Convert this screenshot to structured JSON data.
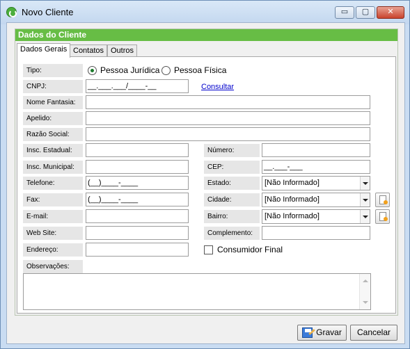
{
  "window": {
    "title": "Novo Cliente",
    "controls": {
      "minimize": "▭",
      "maximize": "▢",
      "close": "✕"
    }
  },
  "group": {
    "title": "Dados do Cliente"
  },
  "tabs": [
    {
      "label": "Dados Gerais"
    },
    {
      "label": "Contatos"
    },
    {
      "label": "Outros"
    }
  ],
  "form": {
    "tipo": {
      "label": "Tipo:",
      "options": [
        "Pessoa Jurídica",
        "Pessoa Física"
      ],
      "selected": "Pessoa Jurídica"
    },
    "cnpj": {
      "label": "CNPJ:",
      "value": "__.___.___/____-__",
      "action": "Consultar"
    },
    "nome_fantasia": {
      "label": "Nome Fantasia:",
      "value": ""
    },
    "apelido": {
      "label": "Apelido:",
      "value": ""
    },
    "razao_social": {
      "label": "Razão Social:",
      "value": ""
    },
    "insc_estadual": {
      "label": "Insc. Estadual:",
      "value": ""
    },
    "insc_municipal": {
      "label": "Insc. Municipal:",
      "value": ""
    },
    "telefone": {
      "label": "Telefone:",
      "value": "(__)____-____"
    },
    "fax": {
      "label": "Fax:",
      "value": "(__)____-____"
    },
    "email": {
      "label": "E-mail:",
      "value": ""
    },
    "website": {
      "label": "Web Site:",
      "value": ""
    },
    "endereco": {
      "label": "Endereço:",
      "value": ""
    },
    "numero": {
      "label": "Número:",
      "value": ""
    },
    "cep": {
      "label": "CEP:",
      "value": "__.___-___"
    },
    "estado": {
      "label": "Estado:",
      "value": "[Não Informado]"
    },
    "cidade": {
      "label": "Cidade:",
      "value": "[Não Informado]"
    },
    "bairro": {
      "label": "Bairro:",
      "value": "[Não Informado]"
    },
    "complemento": {
      "label": "Complemento:",
      "value": ""
    },
    "consumidor_final": {
      "label": "Consumidor Final",
      "checked": false
    },
    "observacoes": {
      "label": "Observações:",
      "value": ""
    }
  },
  "buttons": {
    "save": "Gravar",
    "cancel": "Cancelar"
  }
}
